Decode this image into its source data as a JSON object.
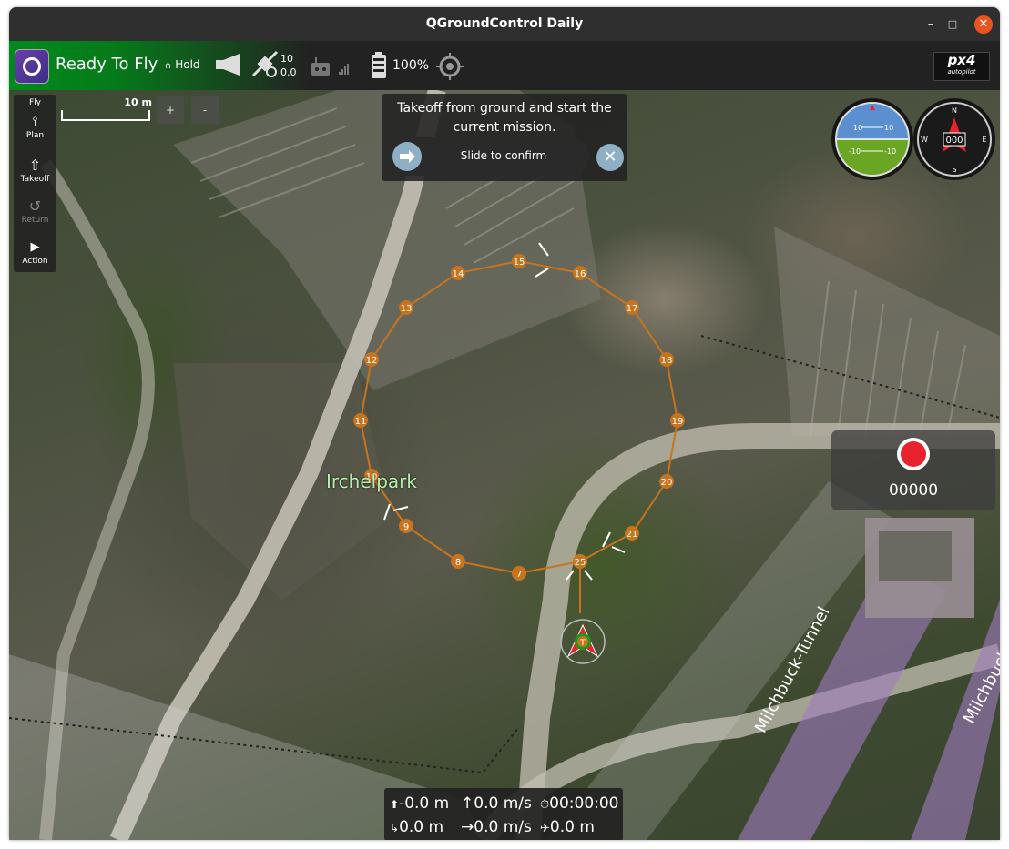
{
  "window": {
    "title": "QGroundControl Daily"
  },
  "toolbar": {
    "status": "Ready To Fly",
    "flight_mode": "Hold",
    "gps_count": "10",
    "gps_hdop": "0.0",
    "battery": "100%",
    "brand": "px4",
    "brand_sub": "autopilot"
  },
  "fly_tools": {
    "header": "Fly",
    "items": [
      {
        "label": "Plan",
        "enabled": true,
        "icon": "plan-icon"
      },
      {
        "label": "Takeoff",
        "enabled": true,
        "icon": "takeoff-icon"
      },
      {
        "label": "Return",
        "enabled": false,
        "icon": "return-icon"
      },
      {
        "label": "Action",
        "enabled": true,
        "icon": "play-icon"
      }
    ]
  },
  "map": {
    "scale_label": "10 m",
    "zoom_in": "+",
    "zoom_out": "-",
    "labels": {
      "park": "Irchelpark",
      "tunnel": "Milchbuck-Tunnel",
      "street": "Milchbuck"
    },
    "waypoints": [
      "7",
      "8",
      "9",
      "10",
      "11",
      "12",
      "13",
      "14",
      "15",
      "16",
      "17",
      "18",
      "19",
      "20",
      "21",
      "25"
    ],
    "home_label": "T",
    "mission_color": "#c8741e"
  },
  "confirm": {
    "message": "Takeoff from ground and start the current mission.",
    "slider_label": "Slide to confirm"
  },
  "instruments": {
    "attitude_labels": [
      "10",
      "10",
      "-10",
      "-10"
    ],
    "compass": {
      "heading": "000",
      "n": "N",
      "e": "E",
      "s": "S",
      "w": "W"
    }
  },
  "recorder": {
    "counter": "00000",
    "color": "#e8232e"
  },
  "telemetry": {
    "altitude": "-0.0 m",
    "vertical_speed": "0.0 m/s",
    "flight_time": "00:00:00",
    "distance": "0.0 m",
    "horizontal_speed": "0.0 m/s",
    "distance_home": "0.0 m"
  }
}
